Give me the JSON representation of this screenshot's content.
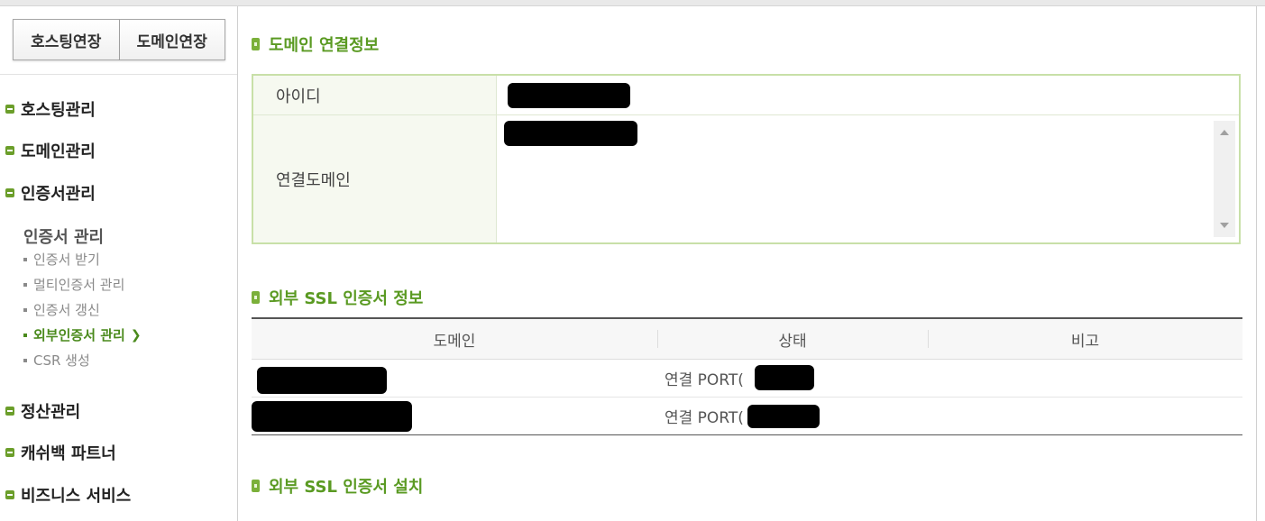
{
  "sidebar": {
    "extend_buttons": [
      "호스팅연장",
      "도메인연장"
    ],
    "menu": [
      "호스팅관리",
      "도메인관리",
      "인증서관리"
    ],
    "cert_sub_title": "인증서 관리",
    "cert_sub_items": [
      "인증서 받기",
      "멀티인증서 관리",
      "인증서 갱신",
      "외부인증서 관리",
      "CSR 생성"
    ],
    "active_sub_index": 3,
    "menu_bottom": [
      "정산관리",
      "캐쉬백 파트너",
      "비즈니스 서비스"
    ]
  },
  "sections": {
    "domain_connect_title": "도메인 연결정보",
    "ssl_info_title": "외부 SSL 인증서 정보",
    "ssl_install_title": "외부 SSL 인증서 설치"
  },
  "info_table": {
    "id_label": "아이디",
    "domain_label": "연결도메인"
  },
  "ssl_table": {
    "headers": [
      "도메인",
      "상태",
      "비고"
    ],
    "rows": [
      {
        "status": "연결 PORT("
      },
      {
        "status": "연결 PORT("
      }
    ]
  },
  "colors": {
    "accent_green": "#5a9a22",
    "box_border": "#c8e0a8"
  }
}
